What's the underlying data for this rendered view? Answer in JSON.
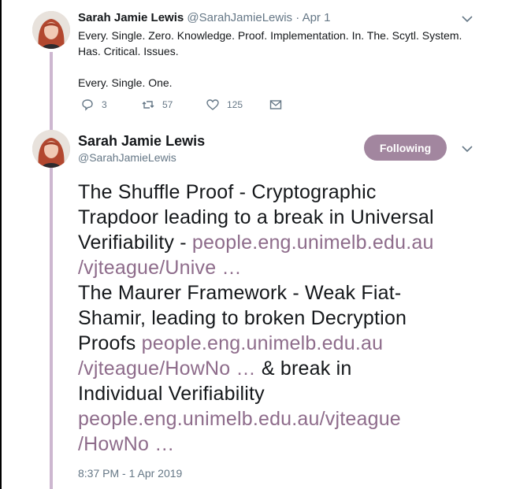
{
  "tweet1": {
    "author_name": "Sarah Jamie Lewis",
    "author_handle": "@SarahJamieLewis",
    "separator": " · ",
    "date": "Apr 1",
    "text_line1": "Every. Single. Zero. Knowledge. Proof. Implementation. In. The. Scytl. System.",
    "text_line2": "Has. Critical. Issues.",
    "text_line3": "Every. Single. One.",
    "replies": "3",
    "retweets": "57",
    "likes": "125",
    "icons": {
      "reply": "reply-icon",
      "retweet": "retweet-icon",
      "like": "heart-icon",
      "message": "mail-icon",
      "menu": "chevron-down-icon"
    }
  },
  "tweet2": {
    "author_name": "Sarah Jamie Lewis",
    "author_handle": "@SarahJamieLewis",
    "follow_label": "Following",
    "body": {
      "l1": "The Shuffle Proof - Cryptographic",
      "l2": "Trapdoor leading to a break in Universal",
      "l3_text": "Verifiability - ",
      "l3_link": "people.eng.unimelb.edu.au",
      "l4_link": "/vjteague/Unive …",
      "l5": "The Maurer Framework - Weak Fiat-",
      "l6": "Shamir, leading to broken Decryption",
      "l7_text": "Proofs ",
      "l7_link": "people.eng.unimelb.edu.au",
      "l8_link": "/vjteague/HowNo …",
      "l8_text": " & break in",
      "l9": "Individual Verifiability",
      "l10_link": "people.eng.unimelb.edu.au/vjteague",
      "l11_link": "/HowNo …"
    },
    "timestamp": "8:37 PM - 1 Apr 2019"
  },
  "colors": {
    "link": "#8e6c8b",
    "follow_button": "#a2869f",
    "thread_line": "#cdb7d0",
    "meta": "#657786"
  }
}
